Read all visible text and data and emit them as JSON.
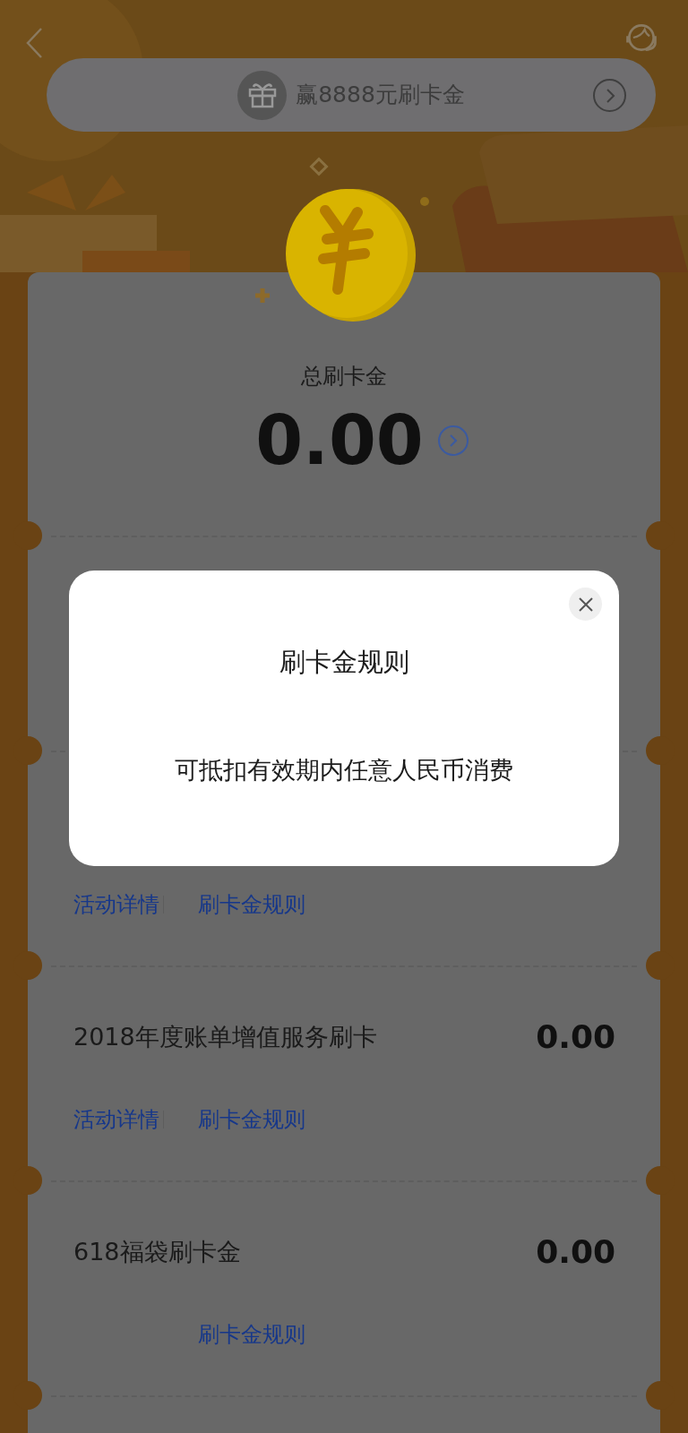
{
  "banner": {
    "text": "赢8888元刷卡金"
  },
  "summary": {
    "label": "总刷卡金",
    "amount": "0.00"
  },
  "sections": [
    {
      "links": [
        {
          "kind": "details",
          "label": "活动详情"
        },
        {
          "kind": "rules",
          "label": "刷卡金规则"
        }
      ]
    },
    {
      "title": "2018年度账单增值服务刷卡",
      "amount": "0.00",
      "links": [
        {
          "kind": "details",
          "label": "活动详情"
        },
        {
          "kind": "rules",
          "label": "刷卡金规则"
        }
      ]
    },
    {
      "title": "618福袋刷卡金",
      "amount": "0.00",
      "links": [
        {
          "kind": "rules",
          "label": "刷卡金规则"
        }
      ]
    }
  ],
  "dialog": {
    "title": "刷卡金规则",
    "body": "可抵扣有效期内任意人民币消费"
  }
}
